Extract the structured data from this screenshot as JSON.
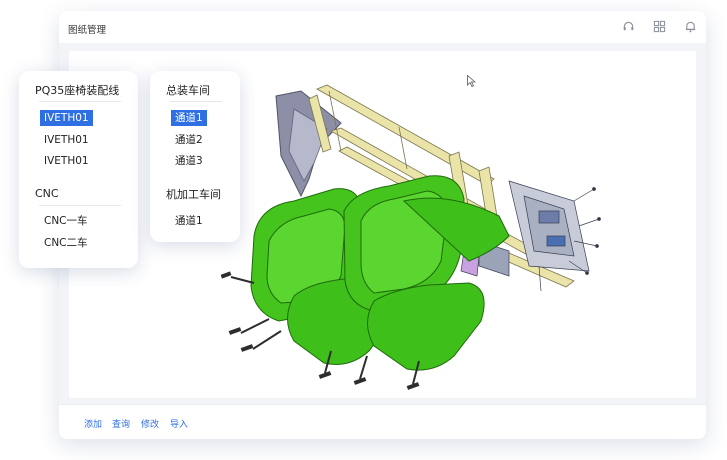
{
  "window": {
    "title": "图纸管理",
    "actions": [
      {
        "name": "headset-icon"
      },
      {
        "name": "grid-icon"
      },
      {
        "name": "bell-icon"
      }
    ]
  },
  "footer": {
    "add": "添加",
    "query": "查询",
    "edit": "修改",
    "import": "导入"
  },
  "left_panel": {
    "group1": {
      "title": "PQ35座椅装配线",
      "items": [
        "IVETH01",
        "IVETH01",
        "IVETH01"
      ],
      "selected_index": 0
    },
    "group2": {
      "title": "CNC",
      "items": [
        "CNC一车",
        "CNC二车"
      ]
    }
  },
  "mid_panel": {
    "group1": {
      "title": "总装车间",
      "items": [
        "通道1",
        "通道2",
        "通道3"
      ],
      "selected_index": 0
    },
    "group2": {
      "title": "机加工车间",
      "items": [
        "通道1"
      ]
    }
  },
  "colors": {
    "accent": "#2f6fe4",
    "seat_green": "#3fbf1a",
    "frame_yellow": "#e9e2a6",
    "frame_gray": "#8c8fa6"
  }
}
